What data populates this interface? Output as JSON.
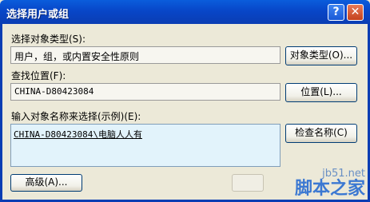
{
  "window": {
    "title": "选择用户或组",
    "help_label": "?",
    "close_label": "✕"
  },
  "object_type": {
    "label": "选择对象类型(S):",
    "value": "用户，组，或内置安全性原则",
    "button": "对象类型(O)..."
  },
  "location": {
    "label": "查找位置(F):",
    "value": "CHINA-D80423084",
    "button": "位置(L)..."
  },
  "names": {
    "label": "输入对象名称来选择(示例)(E):",
    "value": "CHINA-D80423084\\电脑人人有",
    "check_button": "检查名称(C)"
  },
  "footer": {
    "advanced_button": "高级(A)..."
  },
  "watermark": {
    "site": "jb51.net",
    "name": "脚本之家"
  }
}
